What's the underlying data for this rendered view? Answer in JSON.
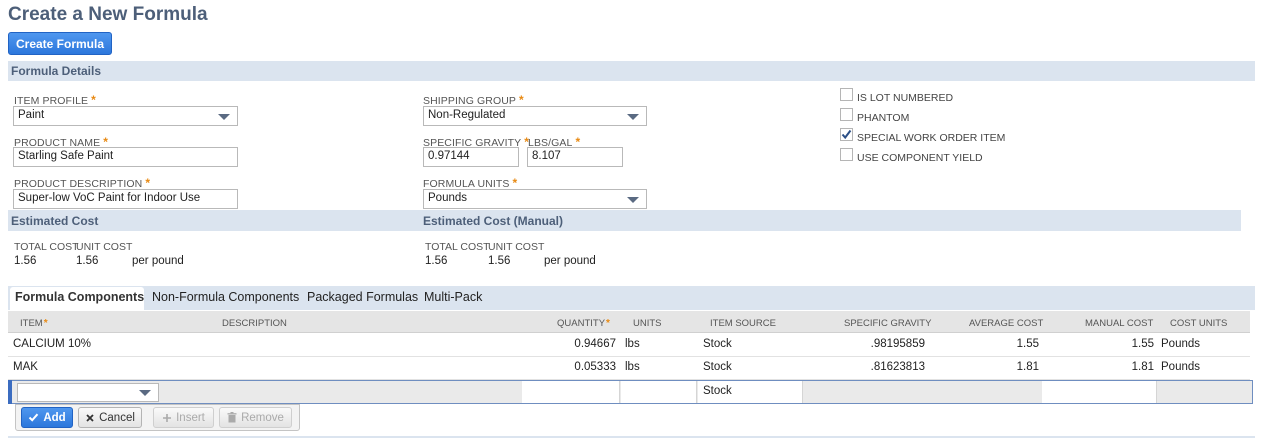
{
  "page": {
    "title": "Create a New Formula",
    "create_button": "Create Formula"
  },
  "sections": {
    "formula_details": "Formula Details",
    "estimated_cost": "Estimated Cost",
    "estimated_cost_manual": "Estimated Cost (Manual)"
  },
  "fields": {
    "item_profile": {
      "label": "ITEM PROFILE",
      "value": "Paint"
    },
    "product_name": {
      "label": "PRODUCT NAME",
      "value": "Starling Safe Paint"
    },
    "product_description": {
      "label": "PRODUCT DESCRIPTION",
      "value": "Super-low VoC Paint for Indoor Use"
    },
    "shipping_group": {
      "label": "SHIPPING GROUP",
      "value": "Non-Regulated"
    },
    "specific_gravity": {
      "label": "SPECIFIC GRAVITY",
      "value": "0.97144"
    },
    "lbs_gal": {
      "label": "LBS/GAL",
      "value": "8.107"
    },
    "formula_units": {
      "label": "FORMULA UNITS",
      "value": "Pounds"
    },
    "required_mark": "*"
  },
  "checkboxes": [
    {
      "label": "IS LOT NUMBERED",
      "checked": false
    },
    {
      "label": "PHANTOM",
      "checked": false
    },
    {
      "label": "SPECIAL WORK ORDER ITEM",
      "checked": true
    },
    {
      "label": "USE COMPONENT YIELD",
      "checked": false
    }
  ],
  "cost": {
    "total_cost_label": "TOTAL COST",
    "unit_cost_label": "UNIT COST",
    "total_cost": "1.56",
    "unit_cost": "1.56",
    "per": "per pound",
    "manual_total_cost": "1.56",
    "manual_unit_cost": "1.56",
    "manual_per": "per pound"
  },
  "tabs": [
    {
      "label": "Formula Components",
      "active": true
    },
    {
      "label": "Non-Formula Components",
      "active": false
    },
    {
      "label": "Packaged Formulas",
      "active": false
    },
    {
      "label": "Multi-Pack",
      "active": false
    }
  ],
  "table": {
    "columns": {
      "item": "ITEM",
      "description": "DESCRIPTION",
      "quantity": "QUANTITY",
      "units": "UNITS",
      "item_source": "ITEM SOURCE",
      "specific_gravity": "SPECIFIC GRAVITY",
      "average_cost": "AVERAGE COST",
      "manual_cost": "MANUAL COST",
      "cost_units": "COST UNITS"
    },
    "rows": [
      {
        "item": "CALCIUM 10%",
        "description": "",
        "quantity": "0.94667",
        "units": "lbs",
        "item_source": "Stock",
        "specific_gravity": ".98195859",
        "average_cost": "1.55",
        "manual_cost": "1.55",
        "cost_units": "Pounds"
      },
      {
        "item": "MAK",
        "description": "",
        "quantity": "0.05333",
        "units": "lbs",
        "item_source": "Stock",
        "specific_gravity": ".81623813",
        "average_cost": "1.81",
        "manual_cost": "1.81",
        "cost_units": "Pounds"
      }
    ],
    "edit_row": {
      "item_source": "Stock"
    }
  },
  "grid_buttons": {
    "add": "Add",
    "cancel": "Cancel",
    "insert": "Insert",
    "remove": "Remove"
  },
  "colors": {
    "accent": "#2c77dc",
    "section": "#dbe4ef",
    "required": "#e88a14",
    "title": "#4d5f79"
  }
}
